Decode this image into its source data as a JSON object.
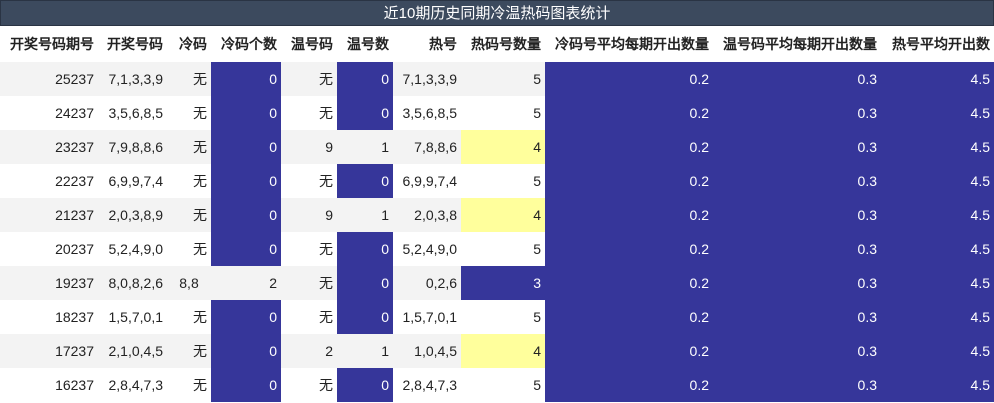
{
  "title": "近10期历史同期冷温热码图表统计",
  "headers": [
    "开奖号码期号",
    "开奖号码",
    "冷码",
    "冷码个数",
    "温号码",
    "温号数",
    "热号",
    "热码号数量",
    "冷码号平均每期开出数量",
    "温号码平均每期开出数量",
    "热号平均开出数"
  ],
  "rows": [
    {
      "issue": "25237",
      "draw": "7,1,3,3,9",
      "cold": "无",
      "cold_count": "0",
      "warm": "无",
      "warm_count": "0",
      "hot": "7,1,3,3,9",
      "hot_count": "5",
      "cold_avg": "0.2",
      "warm_avg": "0.3",
      "hot_avg": "4.5"
    },
    {
      "issue": "24237",
      "draw": "3,5,6,8,5",
      "cold": "无",
      "cold_count": "0",
      "warm": "无",
      "warm_count": "0",
      "hot": "3,5,6,8,5",
      "hot_count": "5",
      "cold_avg": "0.2",
      "warm_avg": "0.3",
      "hot_avg": "4.5"
    },
    {
      "issue": "23237",
      "draw": "7,9,8,8,6",
      "cold": "无",
      "cold_count": "0",
      "warm": "9",
      "warm_count": "1",
      "hot": "7,8,8,6",
      "hot_count": "4",
      "cold_avg": "0.2",
      "warm_avg": "0.3",
      "hot_avg": "4.5"
    },
    {
      "issue": "22237",
      "draw": "6,9,9,7,4",
      "cold": "无",
      "cold_count": "0",
      "warm": "无",
      "warm_count": "0",
      "hot": "6,9,9,7,4",
      "hot_count": "5",
      "cold_avg": "0.2",
      "warm_avg": "0.3",
      "hot_avg": "4.5"
    },
    {
      "issue": "21237",
      "draw": "2,0,3,8,9",
      "cold": "无",
      "cold_count": "0",
      "warm": "9",
      "warm_count": "1",
      "hot": "2,0,3,8",
      "hot_count": "4",
      "cold_avg": "0.2",
      "warm_avg": "0.3",
      "hot_avg": "4.5"
    },
    {
      "issue": "20237",
      "draw": "5,2,4,9,0",
      "cold": "无",
      "cold_count": "0",
      "warm": "无",
      "warm_count": "0",
      "hot": "5,2,4,9,0",
      "hot_count": "5",
      "cold_avg": "0.2",
      "warm_avg": "0.3",
      "hot_avg": "4.5"
    },
    {
      "issue": "19237",
      "draw": "8,0,8,2,6",
      "cold": "8,8",
      "cold_count": "2",
      "warm": "无",
      "warm_count": "0",
      "hot": "0,2,6",
      "hot_count": "3",
      "cold_avg": "0.2",
      "warm_avg": "0.3",
      "hot_avg": "4.5"
    },
    {
      "issue": "18237",
      "draw": "1,5,7,0,1",
      "cold": "无",
      "cold_count": "0",
      "warm": "无",
      "warm_count": "0",
      "hot": "1,5,7,0,1",
      "hot_count": "5",
      "cold_avg": "0.2",
      "warm_avg": "0.3",
      "hot_avg": "4.5"
    },
    {
      "issue": "17237",
      "draw": "2,1,0,4,5",
      "cold": "无",
      "cold_count": "0",
      "warm": "2",
      "warm_count": "1",
      "hot": "1,0,4,5",
      "hot_count": "4",
      "cold_avg": "0.2",
      "warm_avg": "0.3",
      "hot_avg": "4.5"
    },
    {
      "issue": "16237",
      "draw": "2,8,4,7,3",
      "cold": "无",
      "cold_count": "0",
      "warm": "无",
      "warm_count": "0",
      "hot": "2,8,4,7,3",
      "hot_count": "5",
      "cold_avg": "0.2",
      "warm_avg": "0.3",
      "hot_avg": "4.5"
    }
  ],
  "colors": {
    "highlight_blue": "#36369a",
    "highlight_yellow": "#ffff9c",
    "title_bg": "#3c4a5e"
  }
}
